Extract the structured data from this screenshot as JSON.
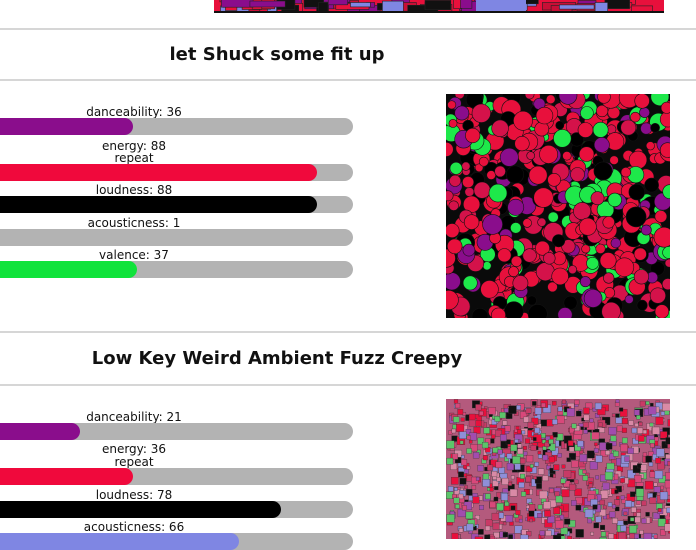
{
  "colors": {
    "danceability": "#8a0d8c",
    "energy": "#f0093c",
    "loudness": "#000000",
    "acousticness": "#7f86e3",
    "valence": "#10e33b",
    "track": "#b3b3b3",
    "divider": "#d6d6d6"
  },
  "playlists": [
    {
      "title": "let Shuck some fit up",
      "art_icon": "playlist-cover-art",
      "features": [
        {
          "label": "danceability: 36",
          "key": "danceability",
          "value": 36
        },
        {
          "label": "energy: 88",
          "key": "energy",
          "value": 88
        },
        {
          "label": "loudness: 88",
          "key": "loudness",
          "value": 88
        },
        {
          "label": "acousticness: 1",
          "key": "acousticness",
          "value": 1
        },
        {
          "label": "valence: 37",
          "key": "valence",
          "value": 37
        }
      ],
      "extra_label": "repeat"
    },
    {
      "title": "Low Key Weird Ambient Fuzz Creepy",
      "art_icon": "playlist-cover-art",
      "features": [
        {
          "label": "danceability: 21",
          "key": "danceability",
          "value": 21
        },
        {
          "label": "energy: 36",
          "key": "energy",
          "value": 36
        },
        {
          "label": "loudness: 78",
          "key": "loudness",
          "value": 78
        },
        {
          "label": "acousticness: 66",
          "key": "acousticness",
          "value": 66
        }
      ],
      "extra_label": "repeat"
    }
  ]
}
